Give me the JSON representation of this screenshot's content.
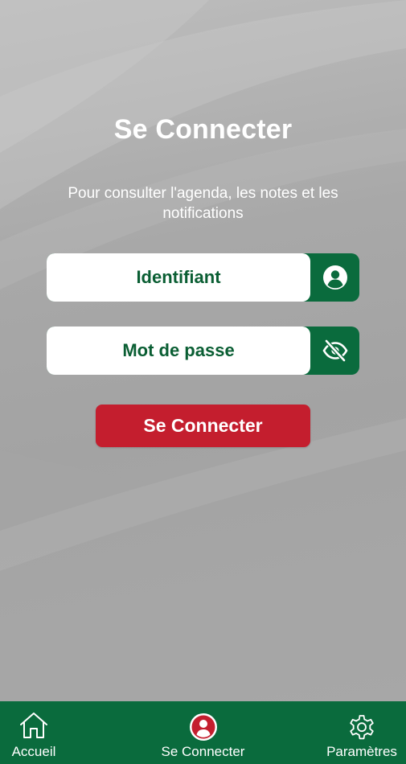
{
  "login": {
    "title": "Se Connecter",
    "subtitle": "Pour consulter l'agenda, les notes et les notifications",
    "username_placeholder": "Identifiant",
    "username_icon": "user-circle-icon",
    "password_placeholder": "Mot de passe",
    "password_icon": "eye-slash-icon",
    "submit_label": "Se Connecter"
  },
  "bottom_nav": {
    "items": [
      {
        "label": "Accueil",
        "icon": "home-icon"
      },
      {
        "label": "Se Connecter",
        "icon": "user-circle-icon",
        "active": true
      },
      {
        "label": "Paramètres",
        "icon": "gear-icon"
      }
    ]
  },
  "colors": {
    "primary_green": "#0a6b3d",
    "accent_red": "#c41e2e",
    "background_gray": "#a9a9a9",
    "white": "#ffffff"
  }
}
